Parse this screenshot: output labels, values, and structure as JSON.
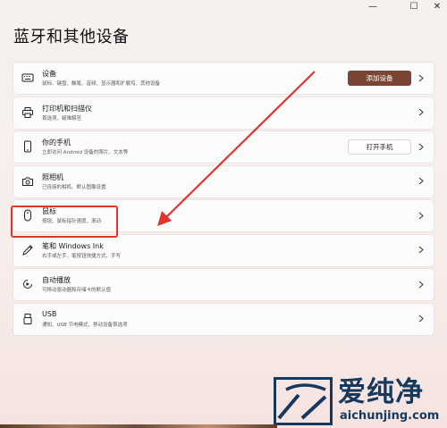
{
  "window": {
    "min_glyph": "—",
    "max_glyph": "☐",
    "close_glyph": "✕"
  },
  "page": {
    "title": "蓝牙和其他设备"
  },
  "rows": [
    {
      "icon": "keyboard-icon",
      "title": "设备",
      "subtitle": "鼠标、键盘、触笔、音频、显示器和扩展坞、其他设备",
      "button": "添加设备"
    },
    {
      "icon": "printer-icon",
      "title": "打印机和扫描仪",
      "subtitle": "首选项、疑难解答"
    },
    {
      "icon": "phone-icon",
      "title": "你的手机",
      "subtitle": "立即访问 Android 设备的照片、文本等",
      "button": "打开手机"
    },
    {
      "icon": "camera-icon",
      "title": "照相机",
      "subtitle": "已连接的相机、默认图像设置"
    },
    {
      "icon": "mouse-icon",
      "title": "鼠标",
      "subtitle": "按钮、鼠标指针速度、滚动"
    },
    {
      "icon": "pen-icon",
      "title": "笔和 Windows Ink",
      "subtitle": "右手或左手、笔按钮快捷方式、手写"
    },
    {
      "icon": "autoplay-icon",
      "title": "自动播放",
      "subtitle": "可移动驱动器和存储卡的默认值"
    },
    {
      "icon": "usb-icon",
      "title": "USB",
      "subtitle": "通知、USB 节电模式、移动设备首选项"
    }
  ],
  "watermark": {
    "name": "爱纯净",
    "url": "aichunjing.com"
  },
  "colors": {
    "accent": "#7a4532",
    "annotation": "#e0332c",
    "watermark": "#15385f"
  }
}
